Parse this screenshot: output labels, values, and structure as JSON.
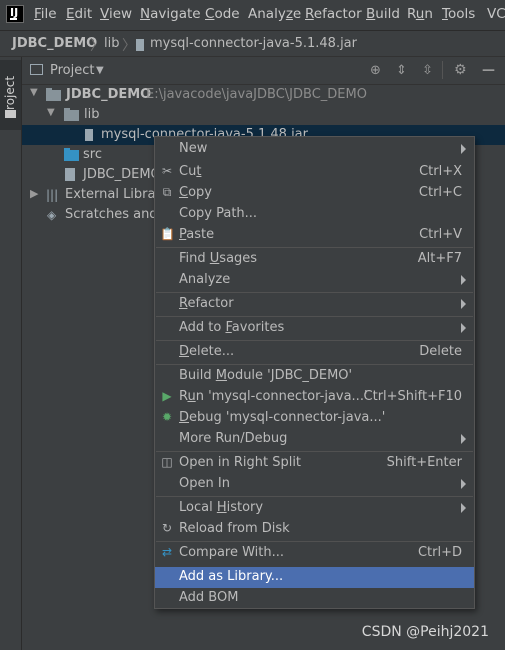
{
  "menubar": {
    "items": [
      {
        "pre": "",
        "u": "F",
        "post": "ile"
      },
      {
        "pre": "",
        "u": "E",
        "post": "dit"
      },
      {
        "pre": "",
        "u": "V",
        "post": "iew"
      },
      {
        "pre": "",
        "u": "N",
        "post": "avigate"
      },
      {
        "pre": "",
        "u": "C",
        "post": "ode"
      },
      {
        "pre": "Analy",
        "u": "z",
        "post": "e"
      },
      {
        "pre": "",
        "u": "R",
        "post": "efactor"
      },
      {
        "pre": "",
        "u": "B",
        "post": "uild"
      },
      {
        "pre": "R",
        "u": "u",
        "post": "n"
      },
      {
        "pre": "",
        "u": "T",
        "post": "ools"
      },
      {
        "pre": "VC",
        "u": "S",
        "post": ""
      }
    ]
  },
  "breadcrumb": {
    "project": "JDBC_DEMO",
    "folder": "lib",
    "file": "mysql-connector-java-5.1.48.jar"
  },
  "toolstrip": {
    "project_tab": "Project"
  },
  "panel": {
    "title": "Project",
    "icons": [
      "locate-icon",
      "expand-all-icon",
      "collapse-all-icon",
      "gear-icon",
      "minimize-icon"
    ]
  },
  "tree": {
    "root_name": "JDBC_DEMO",
    "root_path": "E:\\javacode\\javaJDBC\\JDBC_DEMO",
    "lib": "lib",
    "jar": "mysql-connector-java-5.1.48.jar",
    "src": "src",
    "iml": "JDBC_DEMO",
    "external": "External Librari",
    "scratches": "Scratches and C"
  },
  "context_menu": {
    "items": [
      {
        "label": "New",
        "u": "",
        "shortcut": "",
        "submenu": true,
        "icon": ""
      },
      {
        "label": "Cut",
        "u": "t",
        "shortcut": "Ctrl+X",
        "submenu": false,
        "icon": "✂"
      },
      {
        "label": "Copy",
        "u": "C",
        "shortcut": "Ctrl+C",
        "submenu": false,
        "icon": "⧉"
      },
      {
        "label": "Copy Path...",
        "u": "",
        "shortcut": "",
        "submenu": false,
        "icon": ""
      },
      {
        "label": "Paste",
        "u": "P",
        "shortcut": "Ctrl+V",
        "submenu": false,
        "icon": "📋"
      },
      {
        "label": "Find Usages",
        "u": "U",
        "shortcut": "Alt+F7",
        "submenu": false,
        "icon": ""
      },
      {
        "label": "Analyze",
        "u": "",
        "shortcut": "",
        "submenu": true,
        "icon": ""
      },
      {
        "label": "Refactor",
        "u": "R",
        "shortcut": "",
        "submenu": true,
        "icon": ""
      },
      {
        "label": "Add to Favorites",
        "u": "F",
        "shortcut": "",
        "submenu": true,
        "icon": ""
      },
      {
        "label": "Delete...",
        "u": "D",
        "shortcut": "Delete",
        "submenu": false,
        "icon": ""
      },
      {
        "label": "Build Module 'JDBC_DEMO'",
        "u": "M",
        "shortcut": "",
        "submenu": false,
        "icon": ""
      },
      {
        "label": "Run 'mysql-connector-java...'",
        "u": "u",
        "shortcut": "Ctrl+Shift+F10",
        "submenu": false,
        "icon": "▶"
      },
      {
        "label": "Debug 'mysql-connector-java...'",
        "u": "D",
        "shortcut": "",
        "submenu": false,
        "icon": "✹"
      },
      {
        "label": "More Run/Debug",
        "u": "",
        "shortcut": "",
        "submenu": true,
        "icon": ""
      },
      {
        "label": "Open in Right Split",
        "u": "",
        "shortcut": "Shift+Enter",
        "submenu": false,
        "icon": "◫"
      },
      {
        "label": "Open In",
        "u": "",
        "shortcut": "",
        "submenu": true,
        "icon": ""
      },
      {
        "label": "Local History",
        "u": "H",
        "shortcut": "",
        "submenu": true,
        "icon": ""
      },
      {
        "label": "Reload from Disk",
        "u": "",
        "shortcut": "",
        "submenu": false,
        "icon": "↻"
      },
      {
        "label": "Compare With...",
        "u": "",
        "shortcut": "Ctrl+D",
        "submenu": false,
        "icon": "⇄"
      },
      {
        "label": "Add as Library...",
        "u": "",
        "shortcut": "",
        "submenu": false,
        "icon": "",
        "highlighted": true
      },
      {
        "label": "Add BOM",
        "u": "",
        "shortcut": "",
        "submenu": false,
        "icon": ""
      }
    ]
  },
  "colors": {
    "background": "#3c3f41",
    "selection": "#0d293e",
    "menu_highlight": "#4b6eaf",
    "folder": "#87939a",
    "run_green": "#59a869",
    "compare_blue": "#3592c4"
  },
  "watermark": "CSDN @Peihj2021"
}
